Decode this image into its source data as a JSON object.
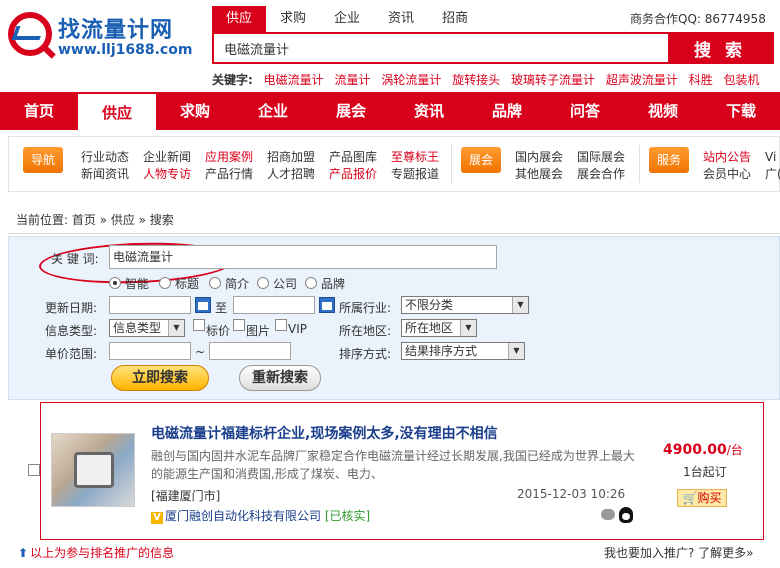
{
  "logo": {
    "name": "找流量计网",
    "url": "www.llj1688.com"
  },
  "search_tabs": [
    "供应",
    "求购",
    "企业",
    "资讯",
    "招商"
  ],
  "search_tab_active": 0,
  "qq_text": "商务合作QQ: 86774958",
  "search": {
    "value": "电磁流量计",
    "button": "搜 索"
  },
  "keywords": {
    "label": "关键字:",
    "items": [
      "电磁流量计",
      "流量计",
      "涡轮流量计",
      "旋转接头",
      "玻璃转子流量计",
      "超声波流量计",
      "科胜",
      "包装机"
    ]
  },
  "nav": [
    "首页",
    "供应",
    "求购",
    "企业",
    "展会",
    "资讯",
    "品牌",
    "问答",
    "视频",
    "下载"
  ],
  "nav_active": 1,
  "subnav": {
    "guide_tag": "导航",
    "guide_cols": [
      [
        "行业动态",
        "新闻资讯"
      ],
      [
        "企业新闻",
        "人物专访"
      ],
      [
        "应用案例",
        "产品行情"
      ],
      [
        "招商加盟",
        "人才招聘"
      ],
      [
        "产品图库",
        "产品报价"
      ],
      [
        "至尊标王",
        "专题报道"
      ]
    ],
    "expo_tag": "展会",
    "expo_cols": [
      [
        "国内展会",
        "其他展会"
      ],
      [
        "国际展会",
        "展会合作"
      ]
    ],
    "service_tag": "服务",
    "service_cols": [
      [
        "站内公告",
        "会员中心"
      ],
      [
        "Vi",
        "广("
      ]
    ]
  },
  "breadcrumb": "当前位置: 首页 » 供应 » 搜索",
  "filter": {
    "keyword_label": "关 键 词:",
    "keyword_value": "电磁流量计",
    "radios": [
      "智能",
      "标题",
      "简介",
      "公司",
      "品牌"
    ],
    "radio_selected": 0,
    "update_label": "更新日期:",
    "to_label": "至",
    "industry_label": "所属行业:",
    "industry_value": "不限分类",
    "info_type_label": "信息类型:",
    "info_type_value": "信息类型",
    "checks": [
      "标价",
      "图片",
      "VIP"
    ],
    "region_label": "所在地区:",
    "region_value": "所在地区",
    "price_label": "单价范围:",
    "price_sep": "~",
    "sort_label": "排序方式:",
    "sort_value": "结果排序方式",
    "search_btn": "立即搜索",
    "reset_btn": "重新搜索"
  },
  "result": {
    "title": "电磁流量计福建标杆企业,现场案例太多,没有理由不相信",
    "desc": "融创与国内固井水泥车品牌厂家稳定合作电磁流量计经过长期发展,我国已经成为世界上最大的能源生产国和消费国,形成了煤炭、电力、",
    "location": "[福建厦门市]",
    "date": "2015-12-03 10:26",
    "company": "厦门融创自动化科技有限公司",
    "verified": "[已核实]",
    "price": "4900.00",
    "price_unit": "/台",
    "moq": "1台起订",
    "buy": "购买"
  },
  "footer": {
    "left": "以上为参与排名推广的信息",
    "right": "我也要加入推广? 了解更多»"
  }
}
